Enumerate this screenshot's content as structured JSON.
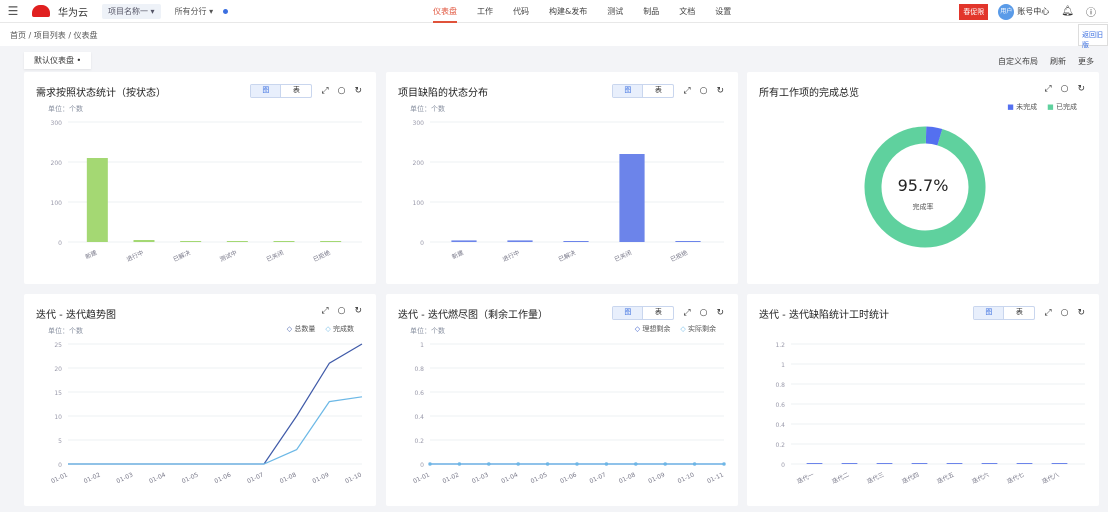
{
  "header": {
    "brand": "华为云",
    "project": "项目名称一",
    "branch": "所有分行",
    "nav": [
      "仪表盘",
      "工作",
      "代码",
      "构建&发布",
      "测试",
      "制品",
      "文档",
      "设置"
    ],
    "active_nav": 0,
    "badge": "春促限",
    "avatar": "用户",
    "user": "账号中心"
  },
  "breadcrumb": "首页 / 项目列表 / 仪表盘",
  "side_tip": "返回旧版",
  "page_tab": "默认仪表盘",
  "actions": [
    "自定义布局",
    "刷新",
    "更多"
  ],
  "cards": [
    {
      "title": "需求按照状态统计（按状态）",
      "toggle": [
        "图",
        "表"
      ],
      "unit": "单位：个数"
    },
    {
      "title": "项目缺陷的状态分布",
      "toggle": [
        "图",
        "表"
      ],
      "unit": "单位：个数"
    },
    {
      "title": "所有工作项的完成总览",
      "legend": [
        "未完成",
        "已完成"
      ],
      "center_value": "95.7%",
      "center_label": "完成率"
    },
    {
      "title": "迭代 - 迭代趋势图",
      "unit": "单位：个数",
      "legend": [
        "总数量",
        "完成数"
      ]
    },
    {
      "title": "迭代 - 迭代燃尽图（剩余工作量）",
      "toggle": [
        "图",
        "表"
      ],
      "unit": "单位：个数",
      "legend": [
        "理想剩余",
        "实际剩余"
      ]
    },
    {
      "title": "迭代 - 迭代缺陷统计工时统计",
      "toggle": [
        "图",
        "表"
      ]
    }
  ],
  "chart_data": [
    {
      "type": "bar",
      "categories": [
        "新建",
        "进行中",
        "已解决",
        "测试中",
        "已关闭",
        "已拒绝"
      ],
      "values": [
        210,
        5,
        1,
        1,
        2,
        1
      ],
      "ylim": [
        0,
        300
      ],
      "yticks": [
        0,
        100,
        200,
        300
      ],
      "color": "#a4d873"
    },
    {
      "type": "bar",
      "categories": [
        "新建",
        "进行中",
        "已解决",
        "已关闭",
        "已拒绝"
      ],
      "values": [
        4,
        4,
        1,
        220,
        1
      ],
      "ylim": [
        0,
        300
      ],
      "yticks": [
        0,
        100,
        200,
        300
      ],
      "color": "#6c84ea"
    },
    {
      "type": "pie",
      "labels": [
        "未完成",
        "已完成"
      ],
      "values": [
        4.3,
        95.7
      ],
      "colors": [
        "#5470f0",
        "#5fd19e"
      ]
    },
    {
      "type": "line",
      "categories": [
        "01-01",
        "01-02",
        "01-03",
        "01-04",
        "01-05",
        "01-06",
        "01-07",
        "01-08",
        "01-09",
        "01-10"
      ],
      "series": [
        {
          "name": "总数量",
          "values": [
            0,
            0,
            0,
            0,
            0,
            0,
            0,
            10,
            21,
            25
          ],
          "color": "#3f5aa8"
        },
        {
          "name": "完成数",
          "values": [
            0,
            0,
            0,
            0,
            0,
            0,
            0,
            3,
            13,
            14
          ],
          "color": "#6cb8e6"
        }
      ],
      "ylim": [
        0,
        25
      ],
      "yticks": [
        0,
        5,
        10,
        15,
        20,
        25
      ]
    },
    {
      "type": "line",
      "categories": [
        "01-01",
        "01-02",
        "01-03",
        "01-04",
        "01-05",
        "01-06",
        "01-07",
        "01-08",
        "01-09",
        "01-10",
        "01-11"
      ],
      "series": [
        {
          "name": "理想剩余",
          "values": [
            0,
            0,
            0,
            0,
            0,
            0,
            0,
            0,
            0,
            0,
            0
          ],
          "color": "#2f55c8"
        },
        {
          "name": "实际剩余",
          "values": [
            0,
            0,
            0,
            0,
            0,
            0,
            0,
            0,
            0,
            0,
            0
          ],
          "color": "#6cb8e6"
        }
      ],
      "ylim": [
        0,
        1
      ],
      "yticks": [
        0,
        0.2,
        0.4,
        0.6,
        0.8,
        1
      ]
    },
    {
      "type": "bar",
      "categories": [
        "迭代一",
        "迭代二",
        "迭代三",
        "迭代四",
        "迭代五",
        "迭代六",
        "迭代七",
        "迭代八"
      ],
      "values": [
        0,
        0,
        0,
        0,
        0,
        0,
        0,
        0
      ],
      "ylim": [
        0,
        1.2
      ],
      "yticks": [
        0,
        0.2,
        0.4,
        0.6,
        0.8,
        1,
        1.2
      ],
      "color": "#6c84ea"
    }
  ]
}
